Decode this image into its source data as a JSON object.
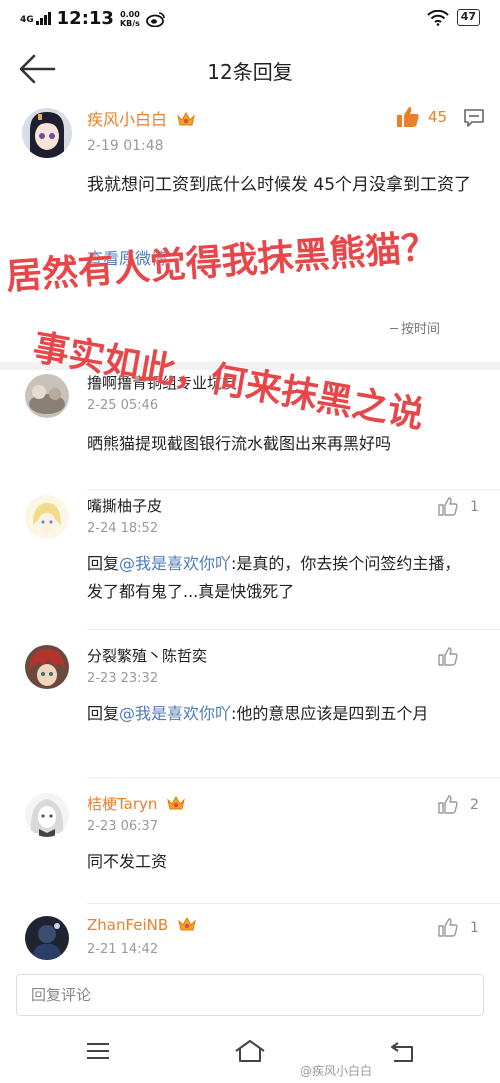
{
  "status_bar": {
    "network": "4G",
    "time": "12:13",
    "speed_value": "0.00",
    "speed_unit": "KB/s",
    "battery": "47"
  },
  "header": {
    "title": "12条回复"
  },
  "main_comment": {
    "username": "疾风小白白",
    "time": "2-19 01:48",
    "text": "我就想问工资到底什么时候发 45个月没拿到工资了",
    "view_original": "查看原微博",
    "like_count": "45",
    "sort_label": "按时间"
  },
  "overlay_text": {
    "line1": "居然有人觉得我抹黑熊猫？",
    "line2": "事实如此，何来抹黑之说"
  },
  "replies": [
    {
      "username": "撸啊撸青铜组专业坑友",
      "time": "2-25 05:46",
      "text_prefix": "",
      "mention": "",
      "text": "晒熊猫提现截图银行流水截图出来再黑好吗",
      "like_count": "",
      "vip": false
    },
    {
      "username": "嘴撕柚子皮",
      "time": "2-24 18:52",
      "text_prefix": "回复",
      "mention": "@我是喜欢你吖",
      "text": ":是真的，你去挨个问签约主播，发了都有鬼了...真是快饿死了",
      "like_count": "1",
      "vip": false
    },
    {
      "username": "分裂繁殖丶陈哲奕",
      "time": "2-23 23:32",
      "text_prefix": "回复",
      "mention": "@我是喜欢你吖",
      "text": ":他的意思应该是四到五个月",
      "like_count": "",
      "vip": false
    },
    {
      "username": "桔梗Taryn",
      "time": "2-23 06:37",
      "text_prefix": "",
      "mention": "",
      "text": "同不发工资",
      "like_count": "2",
      "vip": true
    },
    {
      "username": "ZhanFeiNB",
      "time": "2-21 14:42",
      "text_prefix": "",
      "mention": "",
      "text": "",
      "like_count": "1",
      "vip": true
    }
  ],
  "reply_input": {
    "placeholder": "回复评论"
  },
  "footer_watermark": "@疾风小白白",
  "colors": {
    "accent": "#e9812a",
    "link": "#4d7bb8",
    "overlay": "#e8474a"
  }
}
